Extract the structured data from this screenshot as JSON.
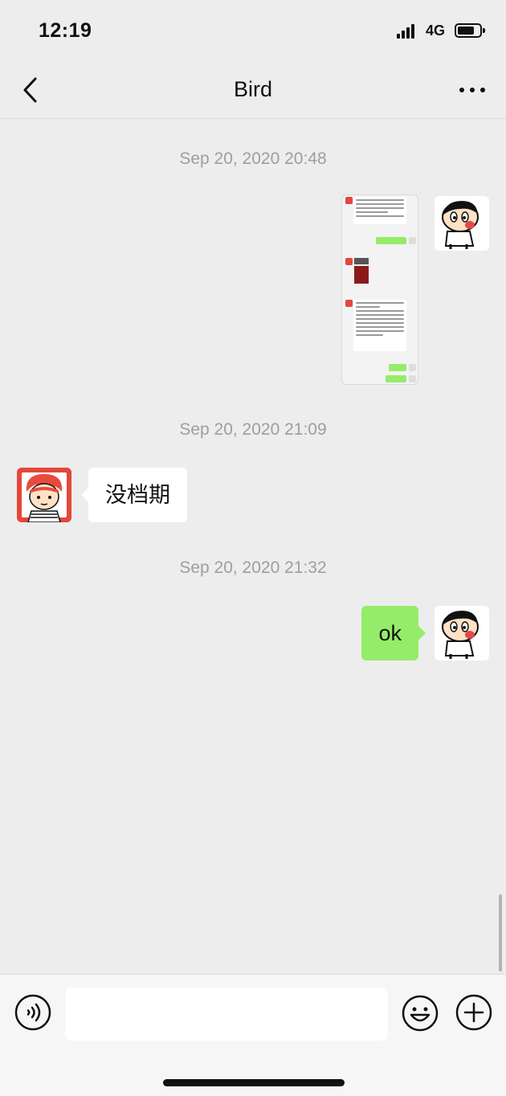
{
  "status_bar": {
    "time": "12:19",
    "network": "4G"
  },
  "chat": {
    "title": "Bird"
  },
  "messages": [
    {
      "timestamp": "Sep 20, 2020 20:48"
    },
    {
      "timestamp": "Sep 20, 2020 21:09",
      "text": "没档期"
    },
    {
      "timestamp": "Sep 20, 2020 21:32",
      "text": "ok"
    }
  ],
  "input": {
    "placeholder": ""
  },
  "icons": {
    "back": "chevron-left-icon",
    "more": "more-horizontal-icon",
    "voice": "voice-icon",
    "emoji": "emoji-icon",
    "plus": "plus-icon"
  },
  "colors": {
    "bubble_out": "#95ec69",
    "bubble_in": "#ffffff",
    "background": "#ededed"
  }
}
